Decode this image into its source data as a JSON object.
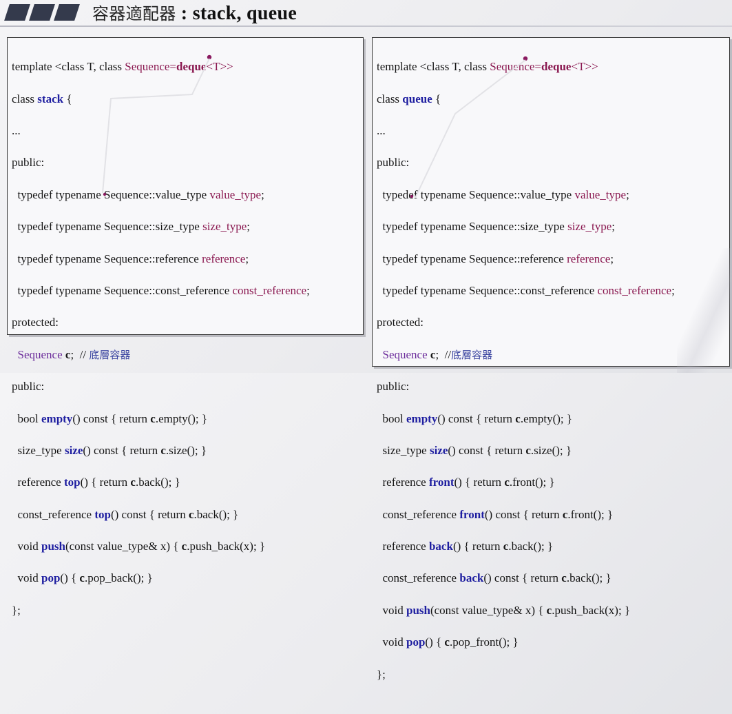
{
  "header": {
    "title_cjk": "容器適配器",
    "title_latin": " : stack, queue"
  },
  "stack": {
    "line1_a": "template <class T, class ",
    "line1_seq": "Sequence",
    "line1_eq": "=",
    "line1_deque": "deque",
    "line1_tail": "<T>>",
    "line2_a": "class ",
    "line2_name": "stack",
    "line2_b": " {",
    "dots": "...",
    "public1": "public:",
    "td1_a": "  typedef typename Sequence::value_type ",
    "td1_b": "value_type",
    "td1_c": ";",
    "td2_a": "  typedef typename Sequence::size_type ",
    "td2_b": "size_type",
    "td2_c": ";",
    "td3_a": "  typedef typename Sequence::reference ",
    "td3_b": "reference",
    "td3_c": ";",
    "td4_a": "  typedef typename Sequence::const_reference ",
    "td4_b": "const_reference",
    "td4_c": ";",
    "protected": "protected:",
    "member_seq": "  Sequence",
    "member_c": " c",
    "member_semi": ";  // ",
    "member_cmt": "底層容器",
    "public2": "public:",
    "m1_a": "  bool ",
    "m1_fn": "empty",
    "m1_b": "() const { return ",
    "m1_c": "c",
    "m1_d": ".empty(); }",
    "m2_a": "  size_type ",
    "m2_fn": "size",
    "m2_b": "() const { return ",
    "m2_c": "c",
    "m2_d": ".size(); }",
    "m3_a": "  reference ",
    "m3_fn": "top",
    "m3_b": "() { return ",
    "m3_c": "c",
    "m3_d": ".back(); }",
    "m4_a": "  const_reference ",
    "m4_fn": "top",
    "m4_b": "() const { return ",
    "m4_c": "c",
    "m4_d": ".back(); }",
    "m5_a": "  void ",
    "m5_fn": "push",
    "m5_b": "(const value_type& x) { ",
    "m5_c": "c",
    "m5_d": ".push_back(x); }",
    "m6_a": "  void ",
    "m6_fn": "pop",
    "m6_b": "() { ",
    "m6_c": "c",
    "m6_d": ".pop_back(); }",
    "end": "};"
  },
  "queue": {
    "line1_a": "template <class T, class ",
    "line1_seq": "Sequence",
    "line1_eq": "=",
    "line1_deque": "deque",
    "line1_tail": "<T>>",
    "line2_a": "class ",
    "line2_name": "queue",
    "line2_b": " {",
    "dots": "...",
    "public1": "public:",
    "td1_a": "  typedef typename Sequence::value_type ",
    "td1_b": "value_type",
    "td1_c": ";",
    "td2_a": "  typedef typename Sequence::size_type ",
    "td2_b": "size_type",
    "td2_c": ";",
    "td3_a": "  typedef typename Sequence::reference ",
    "td3_b": "reference",
    "td3_c": ";",
    "td4_a": "  typedef typename Sequence::const_reference ",
    "td4_b": "const_reference",
    "td4_c": ";",
    "protected": "protected:",
    "member_seq": "  Sequence",
    "member_c": " c",
    "member_semi": ";  //",
    "member_cmt": "底層容器",
    "public2": "public:",
    "m1_a": "  bool ",
    "m1_fn": "empty",
    "m1_b": "() const { return ",
    "m1_c": "c",
    "m1_d": ".empty(); }",
    "m2_a": "  size_type ",
    "m2_fn": "size",
    "m2_b": "() const { return ",
    "m2_c": "c",
    "m2_d": ".size(); }",
    "m3_a": "  reference ",
    "m3_fn": "front",
    "m3_b": "() { return ",
    "m3_c": "c",
    "m3_d": ".front(); }",
    "m4_a": "  const_reference ",
    "m4_fn": "front",
    "m4_b": "() const { return ",
    "m4_c": "c",
    "m4_d": ".front(); }",
    "m5_a": "  reference ",
    "m5_fn": "back",
    "m5_b": "() { return ",
    "m5_c": "c",
    "m5_d": ".back(); }",
    "m6_a": "  const_reference ",
    "m6_fn": "back",
    "m6_b": "() const { return ",
    "m6_c": "c",
    "m6_d": ".back(); }",
    "m7_a": "  void ",
    "m7_fn": "push",
    "m7_b": "(const value_type& x) { ",
    "m7_c": "c",
    "m7_d": ".push_back(x); }",
    "m8_a": "  void ",
    "m8_fn": "pop",
    "m8_b": "() { ",
    "m8_c": "c",
    "m8_d": ".pop_front(); }",
    "end": "};"
  }
}
